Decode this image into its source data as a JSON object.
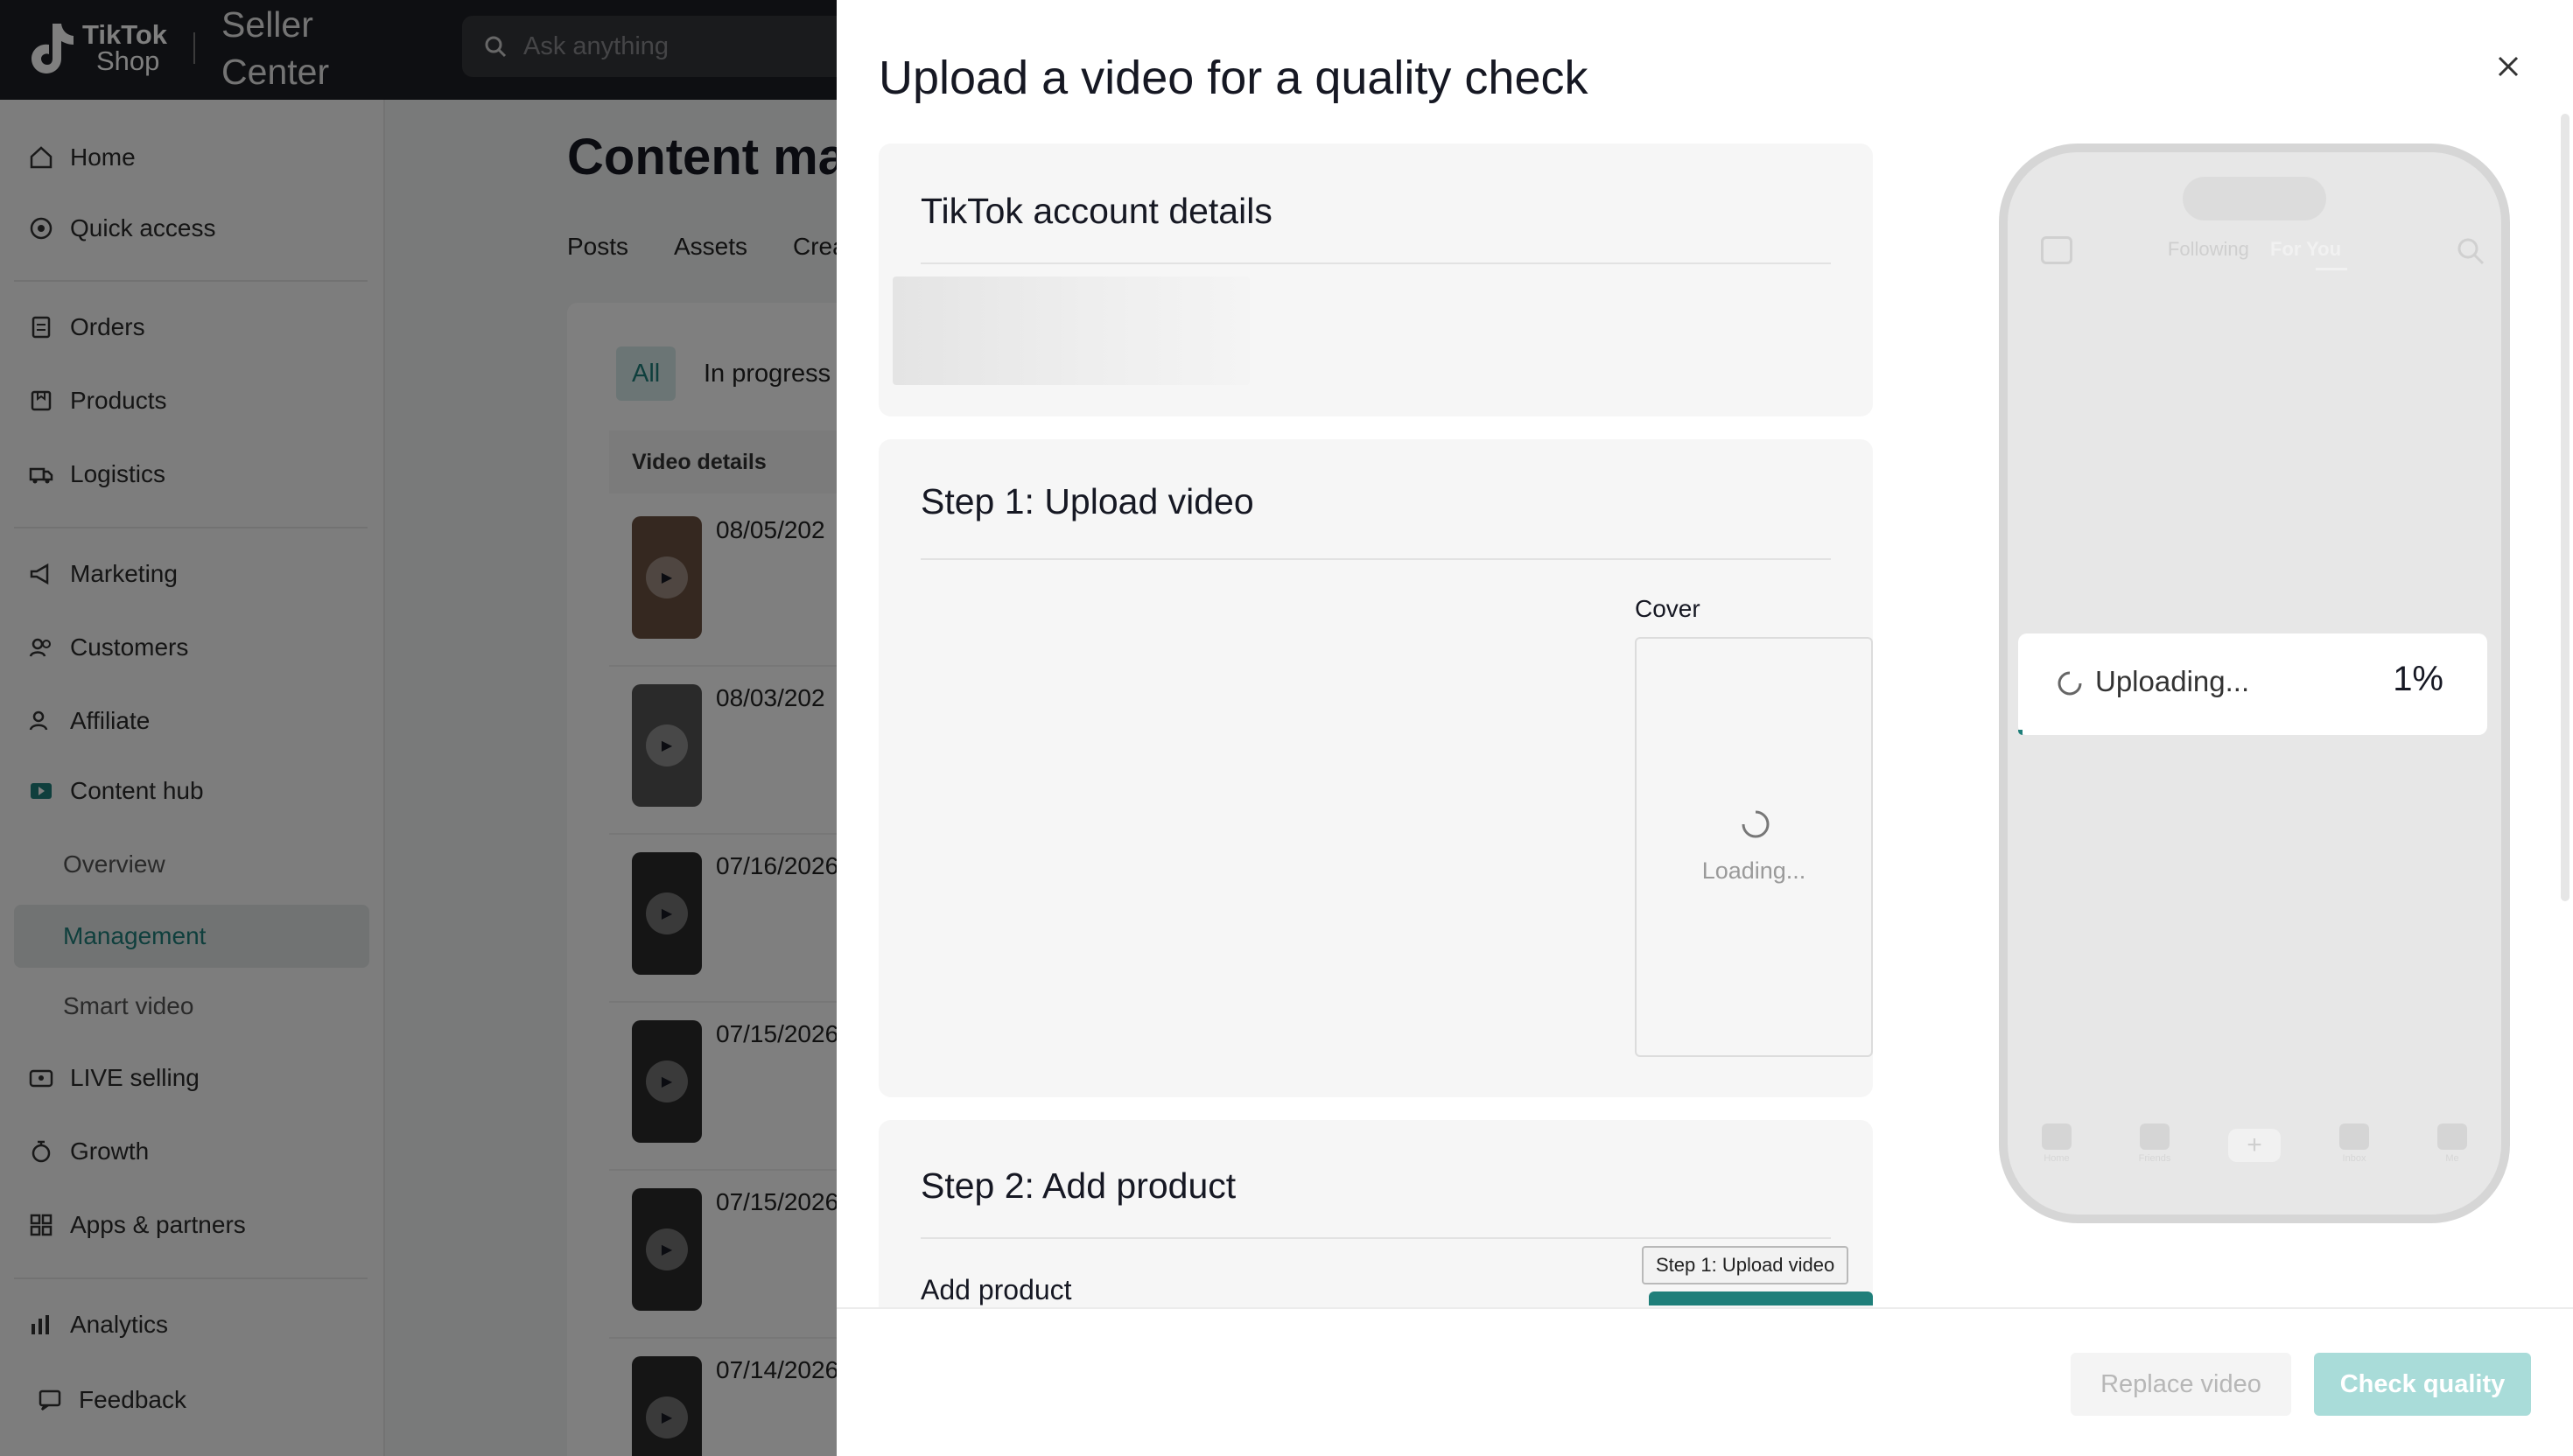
{
  "app": {
    "brand_line1": "TikTok",
    "brand_line2": "Shop",
    "center_label": "Seller Center",
    "search_placeholder": "Ask anything"
  },
  "sidebar": {
    "items": [
      {
        "label": "Home",
        "icon": "home-icon"
      },
      {
        "label": "Quick access",
        "icon": "quick-access-icon"
      },
      {
        "label": "Orders",
        "icon": "orders-icon"
      },
      {
        "label": "Products",
        "icon": "products-icon"
      },
      {
        "label": "Logistics",
        "icon": "truck-icon"
      },
      {
        "label": "Marketing",
        "icon": "megaphone-icon"
      },
      {
        "label": "Customers",
        "icon": "customers-icon"
      },
      {
        "label": "Affiliate",
        "icon": "affiliate-icon"
      },
      {
        "label": "Content hub",
        "icon": "content-hub-icon"
      },
      {
        "label": "LIVE selling",
        "icon": "live-icon"
      },
      {
        "label": "Growth",
        "icon": "growth-icon"
      },
      {
        "label": "Apps & partners",
        "icon": "apps-icon"
      },
      {
        "label": "Analytics",
        "icon": "analytics-icon"
      },
      {
        "label": "Feedback",
        "icon": "feedback-icon"
      }
    ],
    "sub_items": [
      "Overview",
      "Management",
      "Smart video"
    ],
    "active_sub": "Management"
  },
  "main": {
    "title": "Content ma",
    "tabs": [
      "Posts",
      "Assets",
      "Crea"
    ],
    "chips": [
      "All",
      "In progress"
    ],
    "table_header": "Video details",
    "rows": [
      "08/05/202",
      "08/03/202",
      "07/16/2026",
      "07/15/2026",
      "07/15/2026",
      "07/14/2026"
    ]
  },
  "drawer": {
    "title": "Upload a video for a quality check",
    "sections": {
      "account": {
        "title": "TikTok account details"
      },
      "step1": {
        "title": "Step 1: Upload video",
        "cover_label": "Cover",
        "cover_loading": "Loading..."
      },
      "step2": {
        "title": "Step 2: Add product",
        "add_product_label": "Add product"
      }
    },
    "tooltip": "Step 1: Upload video",
    "phone": {
      "tab_following": "Following",
      "tab_for_you": "For You",
      "nav": [
        "Home",
        "Friends",
        "Inbox",
        "Me"
      ]
    },
    "upload": {
      "status": "Uploading...",
      "percent_label": "1%",
      "percent_value": 1
    },
    "buttons": {
      "replace": "Replace video",
      "check": "Check quality"
    },
    "colors": {
      "accent": "#1f7f7a",
      "check_disabled": "#a9dcd9"
    }
  }
}
